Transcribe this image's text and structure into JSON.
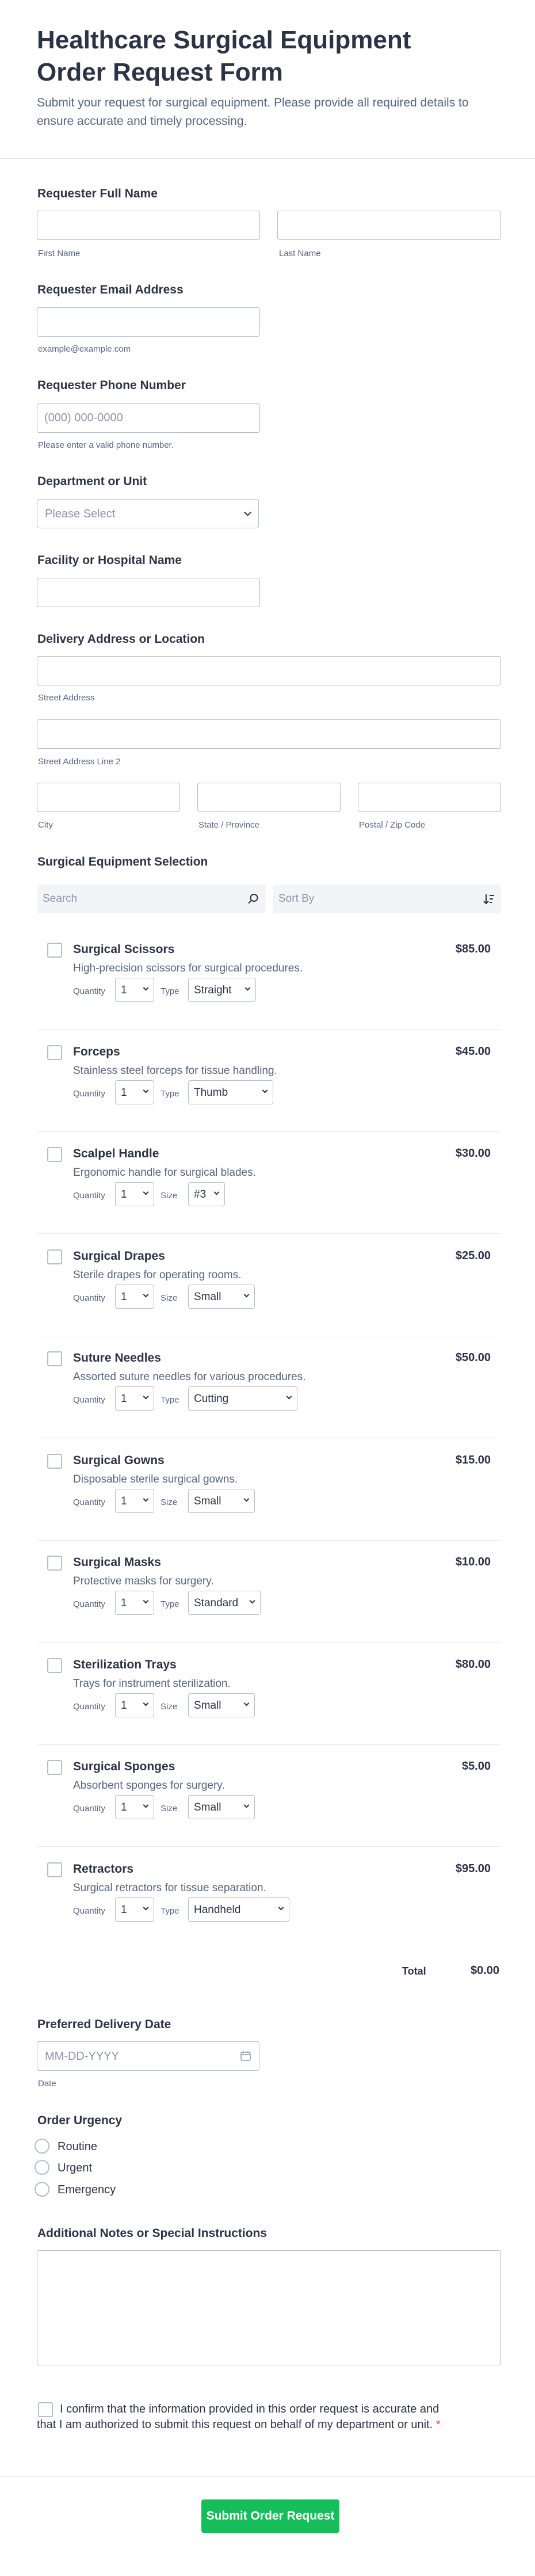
{
  "header": {
    "title": "Healthcare Surgical Equipment Order Request Form",
    "subtitle": "Submit your request for surgical equipment. Please provide all required details to ensure accurate and timely processing."
  },
  "requester_name": {
    "label": "Requester Full Name",
    "first_sublabel": "First Name",
    "last_sublabel": "Last Name"
  },
  "email": {
    "label": "Requester Email Address",
    "sublabel": "example@example.com"
  },
  "phone": {
    "label": "Requester Phone Number",
    "placeholder": "(000) 000-0000",
    "sublabel": "Please enter a valid phone number."
  },
  "department": {
    "label": "Department or Unit",
    "placeholder": "Please Select"
  },
  "facility": {
    "label": "Facility or Hospital Name"
  },
  "address": {
    "label": "Delivery Address or Location",
    "street_sublabel": "Street Address",
    "street2_sublabel": "Street Address Line 2",
    "city_sublabel": "City",
    "state_sublabel": "State / Province",
    "postal_sublabel": "Postal / Zip Code"
  },
  "equipment": {
    "label": "Surgical Equipment Selection",
    "search_placeholder": "Search",
    "sort_placeholder": "Sort By",
    "quantity_label": "Quantity",
    "products": [
      {
        "name": "Surgical Scissors",
        "price": "$85.00",
        "description": "High-precision scissors for surgical procedures.",
        "quantity": "1",
        "option_label": "Type",
        "option_value": "Straight"
      },
      {
        "name": "Forceps",
        "price": "$45.00",
        "description": "Stainless steel forceps for tissue handling.",
        "quantity": "1",
        "option_label": "Type",
        "option_value": "Thumb"
      },
      {
        "name": "Scalpel Handle",
        "price": "$30.00",
        "description": "Ergonomic handle for surgical blades.",
        "quantity": "1",
        "option_label": "Size",
        "option_value": "#3"
      },
      {
        "name": "Surgical Drapes",
        "price": "$25.00",
        "description": "Sterile drapes for operating rooms.",
        "quantity": "1",
        "option_label": "Size",
        "option_value": "Small"
      },
      {
        "name": "Suture Needles",
        "price": "$50.00",
        "description": "Assorted suture needles for various procedures.",
        "quantity": "1",
        "option_label": "Type",
        "option_value": "Cutting"
      },
      {
        "name": "Surgical Gowns",
        "price": "$15.00",
        "description": "Disposable sterile surgical gowns.",
        "quantity": "1",
        "option_label": "Size",
        "option_value": "Small"
      },
      {
        "name": "Surgical Masks",
        "price": "$10.00",
        "description": "Protective masks for surgery.",
        "quantity": "1",
        "option_label": "Type",
        "option_value": "Standard"
      },
      {
        "name": "Sterilization Trays",
        "price": "$80.00",
        "description": "Trays for instrument sterilization.",
        "quantity": "1",
        "option_label": "Size",
        "option_value": "Small"
      },
      {
        "name": "Surgical Sponges",
        "price": "$5.00",
        "description": "Absorbent sponges for surgery.",
        "quantity": "1",
        "option_label": "Size",
        "option_value": "Small"
      },
      {
        "name": "Retractors",
        "price": "$95.00",
        "description": "Surgical retractors for tissue separation.",
        "quantity": "1",
        "option_label": "Type",
        "option_value": "Handheld"
      }
    ],
    "total_label": "Total",
    "total_value": "$0.00"
  },
  "delivery_date": {
    "label": "Preferred Delivery Date",
    "placeholder": "MM-DD-YYYY",
    "sublabel": "Date"
  },
  "urgency": {
    "label": "Order Urgency",
    "options": [
      "Routine",
      "Urgent",
      "Emergency"
    ]
  },
  "notes": {
    "label": "Additional Notes or Special Instructions"
  },
  "confirmation": {
    "text": "I confirm that the information provided in this order request is accurate and that I am authorized to submit this request on behalf of my department or unit.",
    "required_mark": "*"
  },
  "submit": {
    "label": "Submit Order Request",
    "color": "#18bd5b"
  }
}
